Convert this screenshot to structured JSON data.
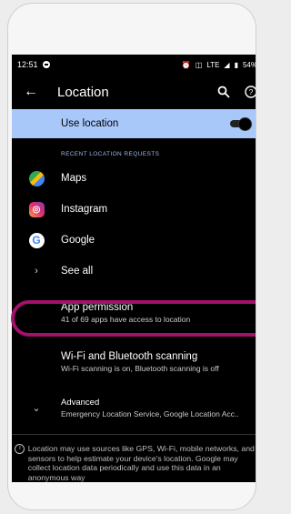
{
  "status": {
    "time": "12:51",
    "network": "LTE",
    "battery": "54%"
  },
  "toolbar": {
    "title": "Location",
    "back_icon": "arrow-back-icon",
    "search_icon": "search-icon",
    "help_icon": "help-icon"
  },
  "use_location": {
    "label": "Use location",
    "enabled": true
  },
  "recent": {
    "header": "RECENT LOCATION REQUESTS",
    "apps": [
      {
        "label": "Maps",
        "icon": "maps-icon"
      },
      {
        "label": "Instagram",
        "icon": "instagram-icon"
      },
      {
        "label": "Google",
        "icon": "google-icon"
      }
    ],
    "see_all": "See all"
  },
  "app_permission": {
    "title": "App permission",
    "summary": "41 of 69 apps have access to location"
  },
  "scanning": {
    "title": "Wi-Fi and Bluetooth scanning",
    "summary": "Wi-Fi scanning is on, Bluetooth scanning is off"
  },
  "advanced": {
    "title": "Advanced",
    "summary": "Emergency Location Service, Google Location Acc.."
  },
  "info_text": "Location may use sources like GPS, Wi-Fi, mobile networks, and sensors to help estimate your device's location. Google may collect location data periodically and use this data in an anonymous way",
  "colors": {
    "accent": "#a8c8fa",
    "highlight": "#a3116b",
    "section_title": "#9bb9ea"
  }
}
